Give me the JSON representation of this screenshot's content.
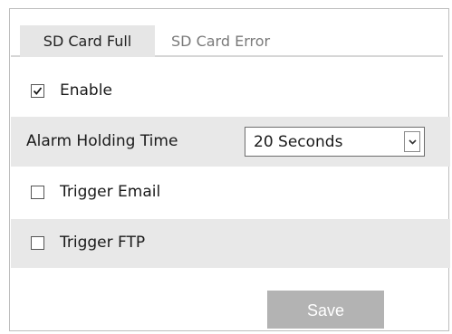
{
  "tabs": [
    {
      "label": "SD Card Full",
      "active": true
    },
    {
      "label": "SD Card Error",
      "active": false
    }
  ],
  "enable": {
    "label": "Enable",
    "checked": true
  },
  "alarm_holding_time": {
    "label": "Alarm Holding Time",
    "selected": "20 Seconds"
  },
  "trigger_email": {
    "label": "Trigger Email",
    "checked": false
  },
  "trigger_ftp": {
    "label": "Trigger FTP",
    "checked": false
  },
  "save_label": "Save",
  "colors": {
    "active_tab_bg": "#e6e6e6",
    "shaded_row_bg": "#e8e8e8",
    "save_button_bg": "#b3b3b3",
    "inactive_tab_text": "#7a7a7a"
  },
  "icons": {
    "checkbox_checked": "checkmark-icon",
    "dropdown": "chevron-down-icon"
  }
}
